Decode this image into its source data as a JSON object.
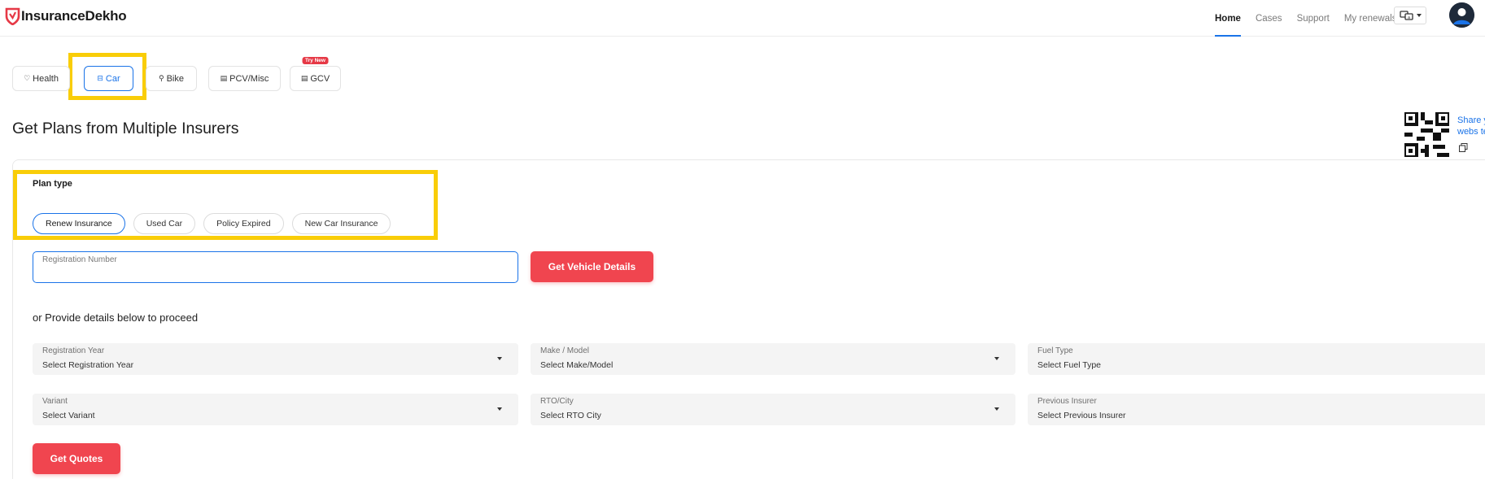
{
  "header": {
    "brand": "InsuranceDekho",
    "nav": [
      {
        "label": "Home",
        "active": true
      },
      {
        "label": "Cases",
        "active": false
      },
      {
        "label": "Support",
        "active": false
      },
      {
        "label": "My renewals",
        "active": false
      }
    ],
    "language_icon": "language-icon",
    "avatar_icon": "user-avatar-icon"
  },
  "product_tabs": [
    {
      "label": "Health",
      "icon": "heart-icon",
      "active": false
    },
    {
      "label": "Car",
      "icon": "car-icon",
      "active": true
    },
    {
      "label": "Bike",
      "icon": "bike-icon",
      "active": false
    },
    {
      "label": "PCV/Misc",
      "icon": "bus-icon",
      "active": false
    },
    {
      "label": "GCV",
      "icon": "truck-icon",
      "active": false,
      "badge": "Try New"
    }
  ],
  "page_title": "Get Plans from Multiple Insurers",
  "share": {
    "text_line1": "Share y",
    "text_line2": "webs te"
  },
  "plan_type": {
    "label": "Plan type",
    "options": [
      {
        "label": "Renew Insurance",
        "active": true
      },
      {
        "label": "Used Car",
        "active": false
      },
      {
        "label": "Policy Expired",
        "active": false
      },
      {
        "label": "New Car Insurance",
        "active": false
      }
    ]
  },
  "registration": {
    "label": "Registration Number",
    "value": ""
  },
  "get_vehicle_button": "Get Vehicle Details",
  "or_text": "or Provide details below to proceed",
  "fields": {
    "reg_year": {
      "label": "Registration Year",
      "value": "Select Registration Year"
    },
    "make_model": {
      "label": "Make / Model",
      "value": "Select Make/Model"
    },
    "fuel_type": {
      "label": "Fuel Type",
      "value": "Select Fuel Type"
    },
    "variant": {
      "label": "Variant",
      "value": "Select Variant"
    },
    "rto_city": {
      "label": "RTO/City",
      "value": "Select RTO City"
    },
    "prev_insurer": {
      "label": "Previous Insurer",
      "value": "Select Previous Insurer"
    }
  },
  "get_quotes_button": "Get Quotes",
  "colors": {
    "brand_red": "#f0454f",
    "accent_blue": "#1a73e8",
    "highlight": "#f9cd08"
  }
}
